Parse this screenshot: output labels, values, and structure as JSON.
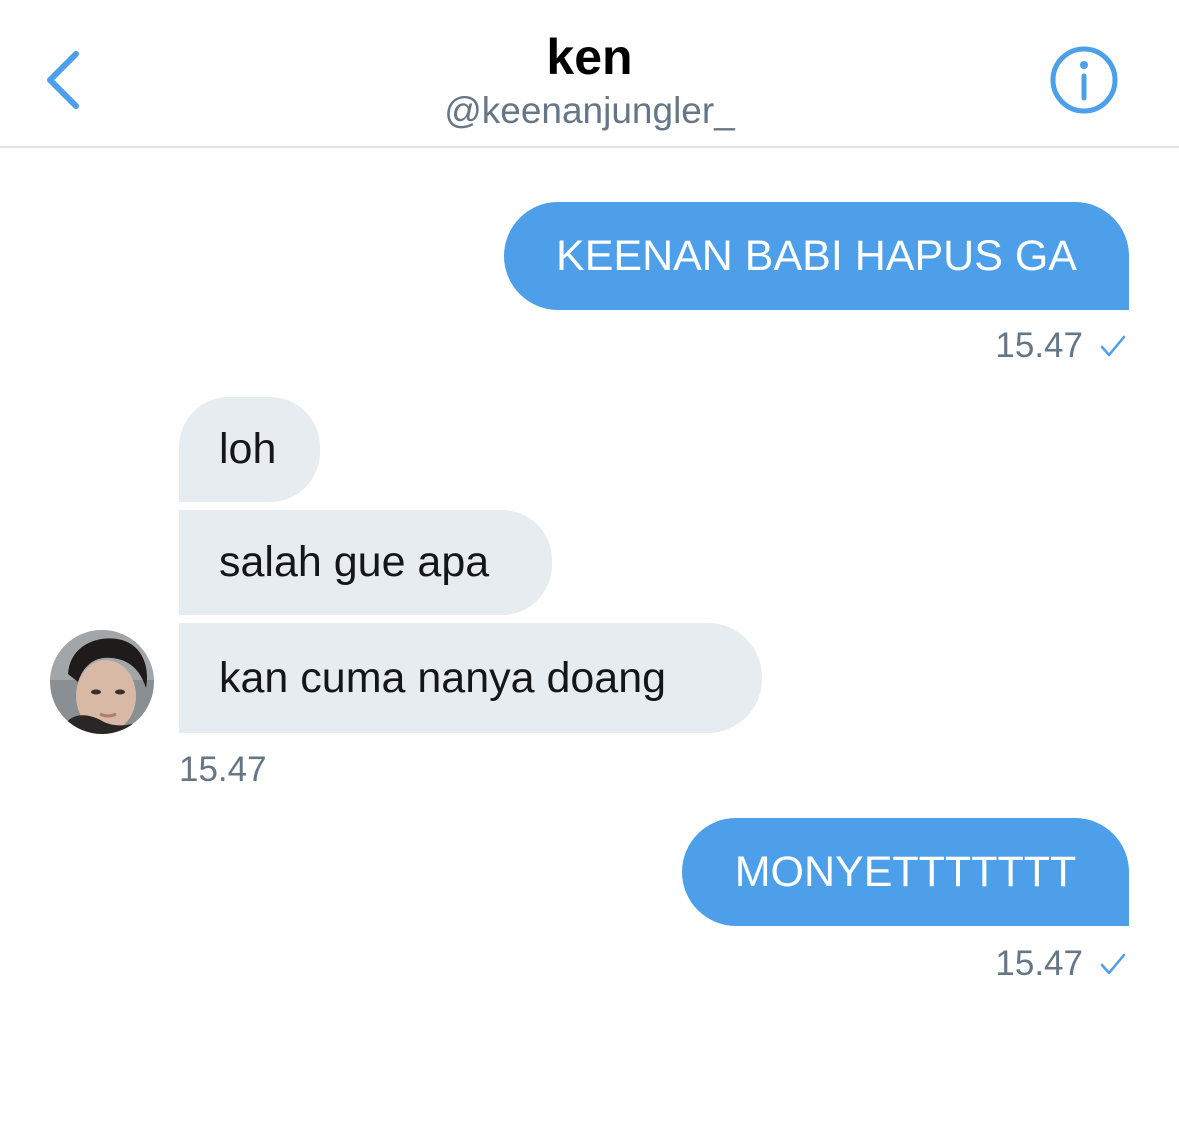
{
  "header": {
    "name": "ken",
    "handle": "@keenanjungler_"
  },
  "messages": [
    {
      "direction": "out",
      "text": "KEENAN BABI HAPUS GA"
    },
    {
      "direction": "out",
      "time": "15.47",
      "status": "sent-check-icon"
    },
    {
      "direction": "in",
      "text": "loh"
    },
    {
      "direction": "in",
      "text": "salah gue apa"
    },
    {
      "direction": "in",
      "text": "kan cuma nanya doang"
    },
    {
      "direction": "in",
      "time": "15.47"
    },
    {
      "direction": "out",
      "text": "MONYETTTTTTT"
    },
    {
      "direction": "out",
      "time": "15.47",
      "status": "sent-check-icon"
    }
  ],
  "colors": {
    "accent": "#4c9fe8",
    "incoming_bubble": "#e6ecf0",
    "secondary_text": "#657786"
  }
}
